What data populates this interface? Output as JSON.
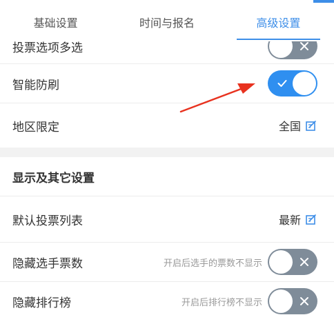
{
  "tabs": [
    {
      "label": "基础设置"
    },
    {
      "label": "时间与报名"
    },
    {
      "label": "高级设置"
    }
  ],
  "rows": {
    "multi_vote": {
      "label": "投票选项多选",
      "state": "off"
    },
    "anti_spam": {
      "label": "智能防刷",
      "state": "on"
    },
    "region": {
      "label": "地区限定",
      "value": "全国"
    },
    "section_title": "显示及其它设置",
    "default_list": {
      "label": "默认投票列表",
      "value": "最新"
    },
    "hide_votes": {
      "label": "隐藏选手票数",
      "hint": "开启后选手的票数不显示",
      "state": "off"
    },
    "hide_rank": {
      "label": "隐藏排行榜",
      "hint": "开启后排行榜不显示",
      "state": "off"
    }
  },
  "colors": {
    "accent": "#3d8ee8",
    "toggle_on": "#2f8ff0",
    "toggle_off": "#7f8c99",
    "arrow": "#e8321f"
  }
}
